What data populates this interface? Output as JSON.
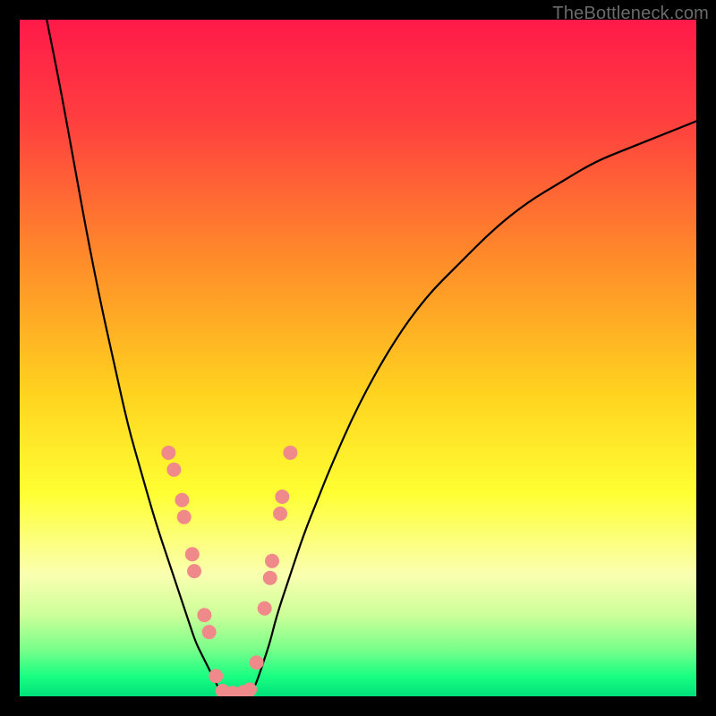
{
  "watermark": "TheBottleneck.com",
  "chart_data": {
    "type": "line",
    "title": "",
    "xlabel": "",
    "ylabel": "",
    "xlim": [
      0,
      100
    ],
    "ylim": [
      0,
      100
    ],
    "grid": false,
    "legend": false,
    "background_gradient_stops": [
      {
        "offset": 0.0,
        "color": "#ff1a49"
      },
      {
        "offset": 0.15,
        "color": "#ff3f3f"
      },
      {
        "offset": 0.35,
        "color": "#ff8a2a"
      },
      {
        "offset": 0.55,
        "color": "#ffd21f"
      },
      {
        "offset": 0.7,
        "color": "#ffff33"
      },
      {
        "offset": 0.82,
        "color": "#faffb0"
      },
      {
        "offset": 0.88,
        "color": "#ccff99"
      },
      {
        "offset": 0.93,
        "color": "#7aff8a"
      },
      {
        "offset": 0.97,
        "color": "#1aff82"
      },
      {
        "offset": 1.0,
        "color": "#00e07a"
      }
    ],
    "series": [
      {
        "name": "left-curve",
        "color": "#000000",
        "x": [
          4,
          6,
          8,
          10,
          12,
          14,
          16,
          18,
          20,
          22,
          23,
          24,
          25,
          26,
          27,
          28,
          29,
          30
        ],
        "y": [
          100,
          90,
          79,
          68,
          58,
          49,
          40,
          33,
          26,
          20,
          17,
          14,
          11,
          8,
          6,
          4,
          2,
          0
        ]
      },
      {
        "name": "right-curve",
        "color": "#000000",
        "x": [
          34,
          35,
          36,
          37,
          38,
          40,
          42,
          44,
          46,
          50,
          55,
          60,
          65,
          70,
          75,
          80,
          85,
          90,
          95,
          100
        ],
        "y": [
          0,
          2,
          5,
          8,
          12,
          18,
          24,
          29,
          34,
          43,
          52,
          59,
          64,
          69,
          73,
          76,
          79,
          81,
          83,
          85
        ]
      },
      {
        "name": "valley-floor",
        "color": "#000000",
        "x": [
          30,
          31,
          32,
          33,
          34
        ],
        "y": [
          0,
          0,
          0,
          0,
          0
        ]
      }
    ],
    "markers": {
      "name": "highlight-dots",
      "color": "#f08a8a",
      "radius": 8,
      "points": [
        {
          "x": 22.0,
          "y": 36.0
        },
        {
          "x": 22.8,
          "y": 33.5
        },
        {
          "x": 24.0,
          "y": 29.0
        },
        {
          "x": 24.3,
          "y": 26.5
        },
        {
          "x": 25.5,
          "y": 21.0
        },
        {
          "x": 25.8,
          "y": 18.5
        },
        {
          "x": 27.3,
          "y": 12.0
        },
        {
          "x": 28.0,
          "y": 9.5
        },
        {
          "x": 29.0,
          "y": 3.0
        },
        {
          "x": 30.0,
          "y": 0.8
        },
        {
          "x": 31.5,
          "y": 0.5
        },
        {
          "x": 33.0,
          "y": 0.6
        },
        {
          "x": 34.0,
          "y": 1.0
        },
        {
          "x": 35.0,
          "y": 5.0
        },
        {
          "x": 36.2,
          "y": 13.0
        },
        {
          "x": 37.0,
          "y": 17.5
        },
        {
          "x": 37.3,
          "y": 20.0
        },
        {
          "x": 38.5,
          "y": 27.0
        },
        {
          "x": 38.8,
          "y": 29.5
        },
        {
          "x": 40.0,
          "y": 36.0
        }
      ]
    }
  }
}
